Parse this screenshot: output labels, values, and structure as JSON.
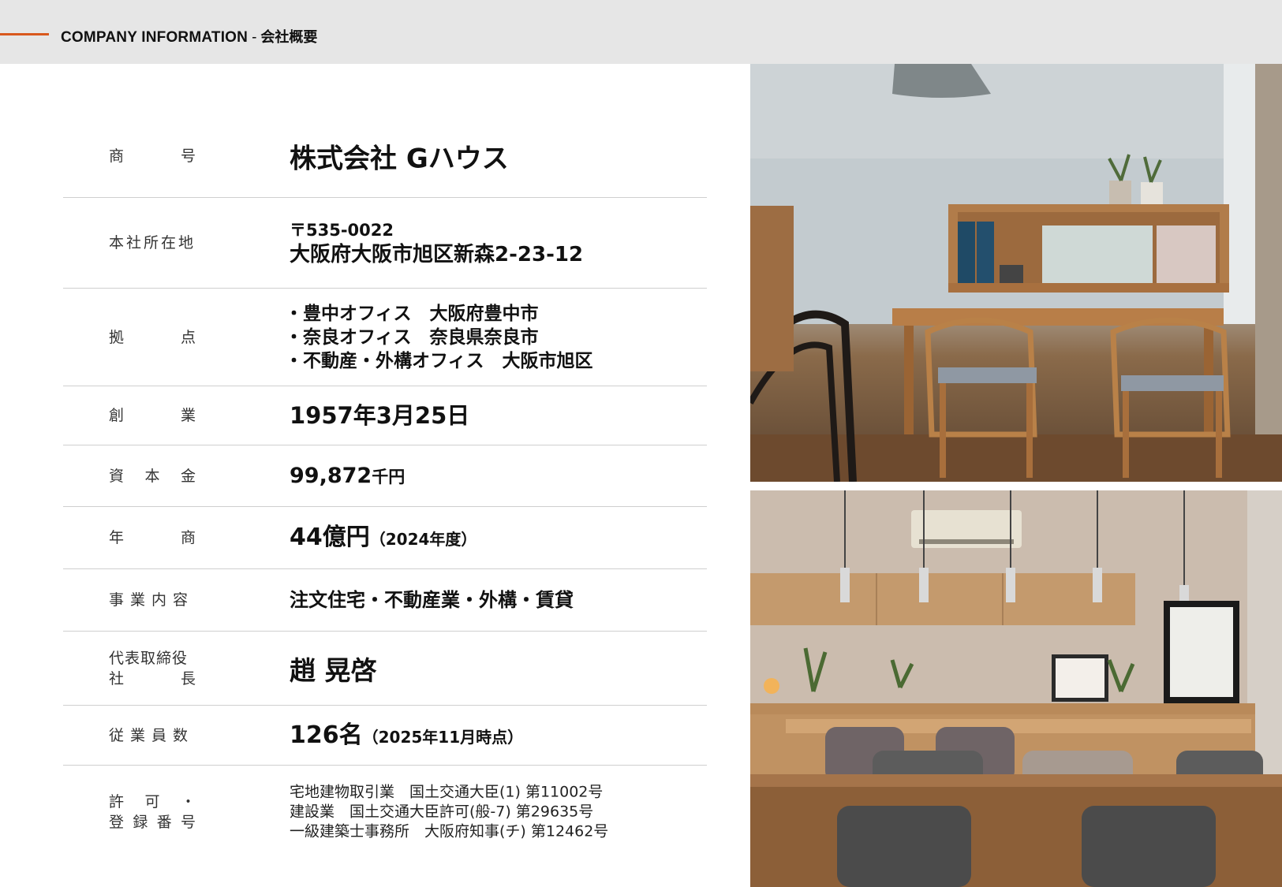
{
  "header": {
    "title_en": "COMPANY INFORMATION",
    "separator": "-",
    "title_ja": "会社概要"
  },
  "rows": [
    {
      "label": [
        "商",
        "号"
      ],
      "value": "株式会社 Gハウス"
    },
    {
      "label": [
        "本社所在地"
      ],
      "postal": "〒535-0022",
      "address": "大阪府大阪市旭区新森2-23-12"
    },
    {
      "label": [
        "拠",
        "点"
      ],
      "offices": [
        "・豊中オフィス　大阪府豊中市",
        "・奈良オフィス　奈良県奈良市",
        "・不動産・外構オフィス　大阪市旭区"
      ]
    },
    {
      "label": [
        "創",
        "業"
      ],
      "value": "1957年3月25日"
    },
    {
      "label": [
        "資",
        "本",
        "金"
      ],
      "value_num": "99,872",
      "value_unit": "千円"
    },
    {
      "label": [
        "年",
        "商"
      ],
      "value_num": "44億円",
      "value_note": "（2024年度）"
    },
    {
      "label": [
        "事業内容"
      ],
      "value": "注文住宅・不動産業・外構・賃貸"
    },
    {
      "label_lines": [
        [
          "代表取締役"
        ],
        [
          "社",
          "長"
        ]
      ],
      "value": "趙 晃啓"
    },
    {
      "label": [
        "従業員数"
      ],
      "value_num": "126名",
      "value_note": "（2025年11月時点）"
    },
    {
      "label_lines": [
        [
          "許",
          "可",
          "・"
        ],
        [
          "登",
          "録",
          "番",
          "号"
        ]
      ],
      "licenses": [
        "宅地建物取引業　国土交通大臣(1) 第11002号",
        "建設業　国土交通大臣許可(般-7) 第29635号",
        "一級建築士事務所　大阪府知事(チ) 第12462号"
      ]
    }
  ]
}
